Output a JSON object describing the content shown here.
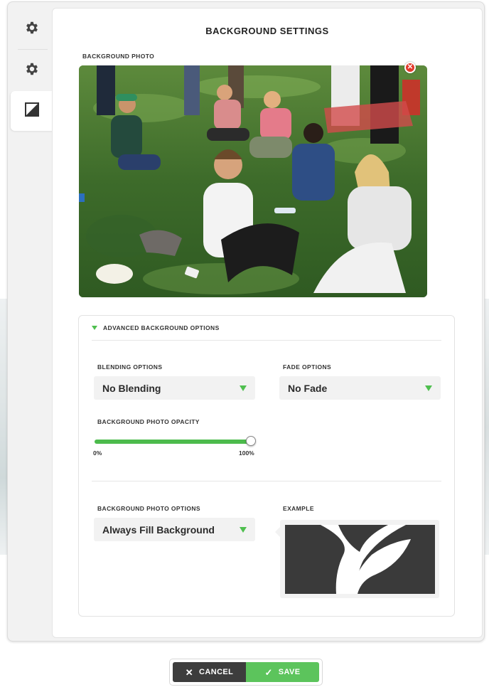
{
  "title": "BACKGROUND SETTINGS",
  "tabs": [
    {
      "icon": "gear-icon",
      "active": false
    },
    {
      "icon": "gear-icon",
      "active": false
    },
    {
      "icon": "contrast-icon",
      "active": true
    }
  ],
  "photo_section": {
    "label": "BACKGROUND PHOTO",
    "remove_icon": "close-icon"
  },
  "advanced": {
    "header": "ADVANCED BACKGROUND OPTIONS",
    "blending": {
      "label": "BLENDING OPTIONS",
      "value": "No Blending"
    },
    "fade": {
      "label": "FADE OPTIONS",
      "value": "No Fade"
    },
    "opacity": {
      "label": "BACKGROUND PHOTO OPACITY",
      "min_label": "0%",
      "max_label": "100%",
      "value_percent": 100
    },
    "photo_options": {
      "label": "BACKGROUND PHOTO OPTIONS",
      "value": "Always Fill Background"
    },
    "example": {
      "label": "EXAMPLE"
    }
  },
  "actions": {
    "cancel_label": "CANCEL",
    "save_label": "SAVE"
  },
  "colors": {
    "accent_green": "#5cc45c",
    "dark_button": "#3d3d3d",
    "remove_red": "#e23a2c"
  }
}
